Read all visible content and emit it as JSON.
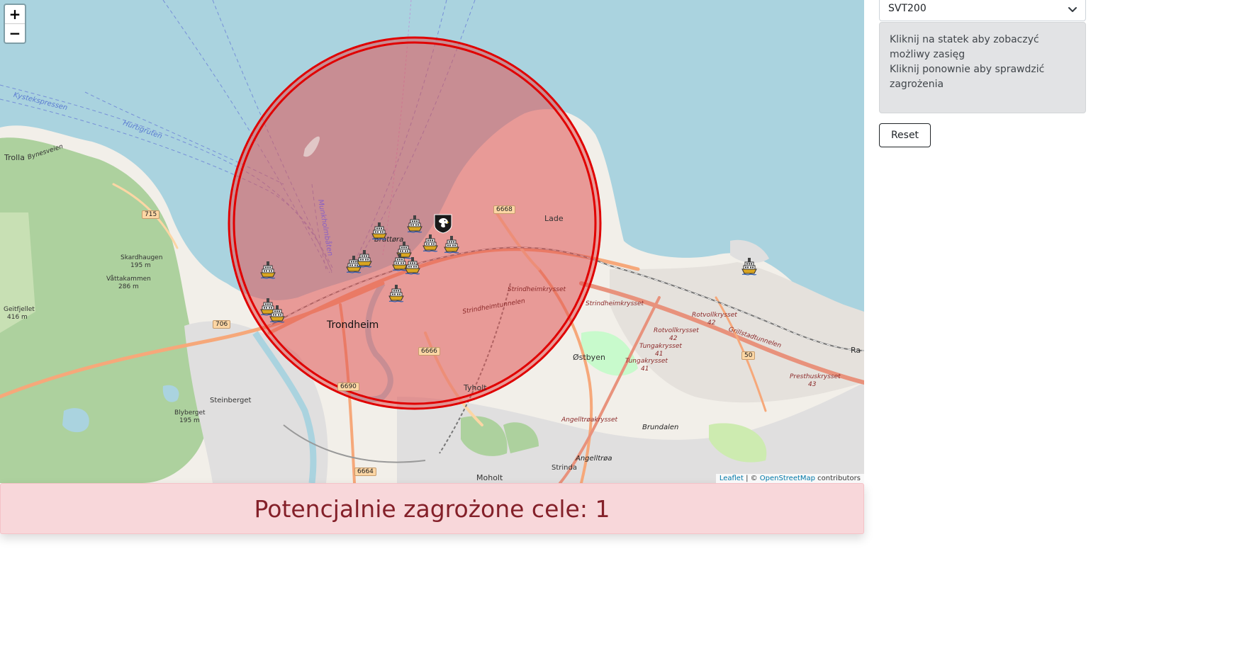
{
  "map": {
    "zoom_in": "+",
    "zoom_out": "−",
    "attribution": {
      "leaflet": "Leaflet",
      "separator": " | © ",
      "osm": "OpenStreetMap",
      "suffix": " contributors"
    },
    "labels": {
      "trondheim": "Trondheim",
      "lade": "Lade",
      "ostbyen": "Østbyen",
      "tyholt": "Tyholt",
      "moholt": "Moholt",
      "strinda": "Strinda",
      "trolla": "Trolla",
      "steinberget": "Steinberget",
      "brundalen": "Brundalen",
      "angelltroa": "Angelltrøa",
      "brattora": "Brattøra",
      "skardhaugen": "Skardhaugen",
      "skardhaugen_alt": "195 m",
      "vattakammen": "Våttakammen",
      "vattakammen_alt": "286 m",
      "geitfjellet": "Geitfjellet",
      "geitfjellet_alt": "416 m",
      "blyberget": "Blyberget",
      "blyberget_alt": "195 m",
      "hurtigruten": "Hurtigruten",
      "kystekspressen": "Kystekspressen",
      "munkholmbaten": "Munkholmbåten",
      "strindheimkrysset": "Strindheimkrysset",
      "strindheimkrysset2": "Strindheimkrysset",
      "strindheimtunnelen": "Strindheimtunnelen",
      "rotvollkrysset": "Rotvollkrysset",
      "rotvollkrysset_num": "42",
      "tungakrysset": "Tungakrysset",
      "tungakrysset_num": "41",
      "presthuskrysset": "Presthuskrysset",
      "presthuskrysset_num": "43",
      "angelltroakrysset": "Angelltrøakrysset",
      "grillstadtunnelen": "Grillstadtunnelen",
      "bynesveien": "Bynesveien",
      "ra": "Ra"
    },
    "shields": [
      "6668",
      "715",
      "706",
      "6666",
      "6690",
      "6664",
      "50"
    ],
    "icons": {
      "ship": "ship-icon",
      "eagle": "eagle-icon"
    }
  },
  "banner": {
    "text": "Potencjalnie zagrożone cele: 1"
  },
  "sidebar": {
    "select_value": "SVT200",
    "info_line1": "Kliknij na statek aby zobaczyć możliwy zasięg",
    "info_line2": "Kliknij ponownie aby sprawdzić zagrożenia",
    "reset_label": "Reset"
  },
  "colors": {
    "water": "#aad3df",
    "land": "#f2efe9",
    "forest": "#add19e",
    "range_fill": "#e05454",
    "range_stroke": "#e00000",
    "banner_bg": "#f8d7da",
    "banner_text": "#842029"
  }
}
